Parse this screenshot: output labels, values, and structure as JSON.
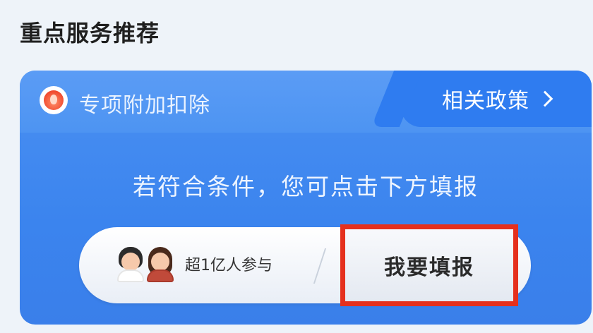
{
  "section": {
    "title": "重点服务推荐"
  },
  "card": {
    "title": "专项附加扣除",
    "icon": "flame-logo-icon",
    "policy_link": {
      "label": "相关政策",
      "icon": "chevron-right-icon"
    },
    "prompt": "若符合条件，您可点击下方填报",
    "participants": {
      "text": "超1亿人参与",
      "icon": "avatars-icon"
    },
    "action_button": {
      "label": "我要填报",
      "highlight_color": "#e5301d"
    }
  },
  "colors": {
    "card_blue": "#3b84ee",
    "policy_tab_blue": "#2f7cf0",
    "page_background": "#eef3f9"
  }
}
